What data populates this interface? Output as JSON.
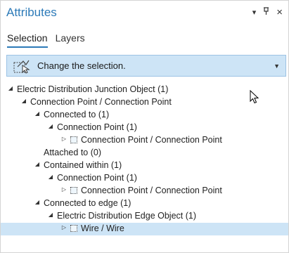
{
  "pane": {
    "title": "Attributes",
    "controls": {
      "menu": "▾",
      "pin": "ⅎ",
      "close": "×"
    }
  },
  "tabs": [
    {
      "label": "Selection",
      "active": true
    },
    {
      "label": "Layers",
      "active": false
    }
  ],
  "selection_bar": {
    "icon": "select-by-rectangle-icon",
    "label": "Change the selection.",
    "dropdown_icon": "chevron-down-icon"
  },
  "tree": [
    {
      "level": 0,
      "expander": "expanded",
      "label": "Electric Distribution Junction Object (1)"
    },
    {
      "level": 1,
      "expander": "expanded",
      "label": "Connection Point / Connection Point"
    },
    {
      "level": 2,
      "expander": "expanded",
      "label": "Connected to (1)"
    },
    {
      "level": 3,
      "expander": "expanded",
      "label": "Connection Point (1)"
    },
    {
      "level": 4,
      "expander": "collapsed",
      "feature": true,
      "label": "Connection Point / Connection Point"
    },
    {
      "level": 2,
      "expander": "none",
      "label": "Attached to (0)"
    },
    {
      "level": 2,
      "expander": "expanded",
      "label": "Contained within (1)"
    },
    {
      "level": 3,
      "expander": "expanded",
      "label": "Connection Point (1)"
    },
    {
      "level": 4,
      "expander": "collapsed",
      "feature": true,
      "label": "Connection Point / Connection Point"
    },
    {
      "level": 2,
      "expander": "expanded",
      "label": "Connected to edge (1)"
    },
    {
      "level": 3,
      "expander": "expanded",
      "label": "Electric Distribution Edge Object (1)"
    },
    {
      "level": 4,
      "expander": "collapsed",
      "feature": true,
      "label": "Wire / Wire",
      "selected": true
    }
  ],
  "colors": {
    "accent": "#2c7ab8",
    "selection_bg": "#cde4f6",
    "selection_border": "#9cc3e5"
  }
}
